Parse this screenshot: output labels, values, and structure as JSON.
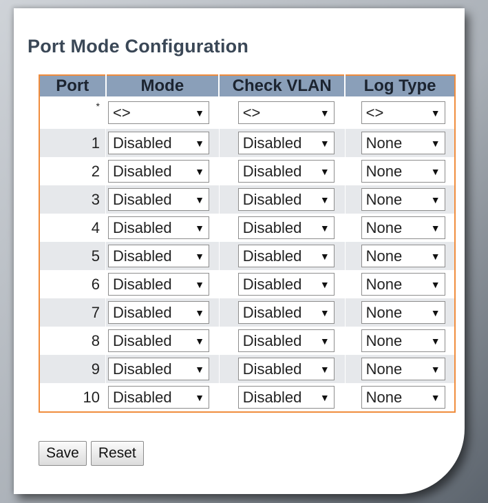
{
  "page": {
    "title": "Port Mode Configuration"
  },
  "table": {
    "headers": {
      "port": "Port",
      "mode": "Mode",
      "check_vlan": "Check VLAN",
      "log_type": "Log Type"
    },
    "wildcard_row": {
      "port": "*",
      "mode": "<>",
      "check_vlan": "<>",
      "log_type": "<>"
    },
    "rows": [
      {
        "port": "1",
        "mode": "Disabled",
        "check_vlan": "Disabled",
        "log_type": "None"
      },
      {
        "port": "2",
        "mode": "Disabled",
        "check_vlan": "Disabled",
        "log_type": "None"
      },
      {
        "port": "3",
        "mode": "Disabled",
        "check_vlan": "Disabled",
        "log_type": "None"
      },
      {
        "port": "4",
        "mode": "Disabled",
        "check_vlan": "Disabled",
        "log_type": "None"
      },
      {
        "port": "5",
        "mode": "Disabled",
        "check_vlan": "Disabled",
        "log_type": "None"
      },
      {
        "port": "6",
        "mode": "Disabled",
        "check_vlan": "Disabled",
        "log_type": "None"
      },
      {
        "port": "7",
        "mode": "Disabled",
        "check_vlan": "Disabled",
        "log_type": "None"
      },
      {
        "port": "8",
        "mode": "Disabled",
        "check_vlan": "Disabled",
        "log_type": "None"
      },
      {
        "port": "9",
        "mode": "Disabled",
        "check_vlan": "Disabled",
        "log_type": "None"
      },
      {
        "port": "10",
        "mode": "Disabled",
        "check_vlan": "Disabled",
        "log_type": "None"
      }
    ]
  },
  "buttons": {
    "save": "Save",
    "reset": "Reset"
  },
  "icons": {
    "dropdown": "dropdown-arrow-icon"
  },
  "colors": {
    "header_bg": "#8a9fb9",
    "table_border": "#f08c3c",
    "title": "#3a4756",
    "alt_row": "#e6e8eb"
  }
}
